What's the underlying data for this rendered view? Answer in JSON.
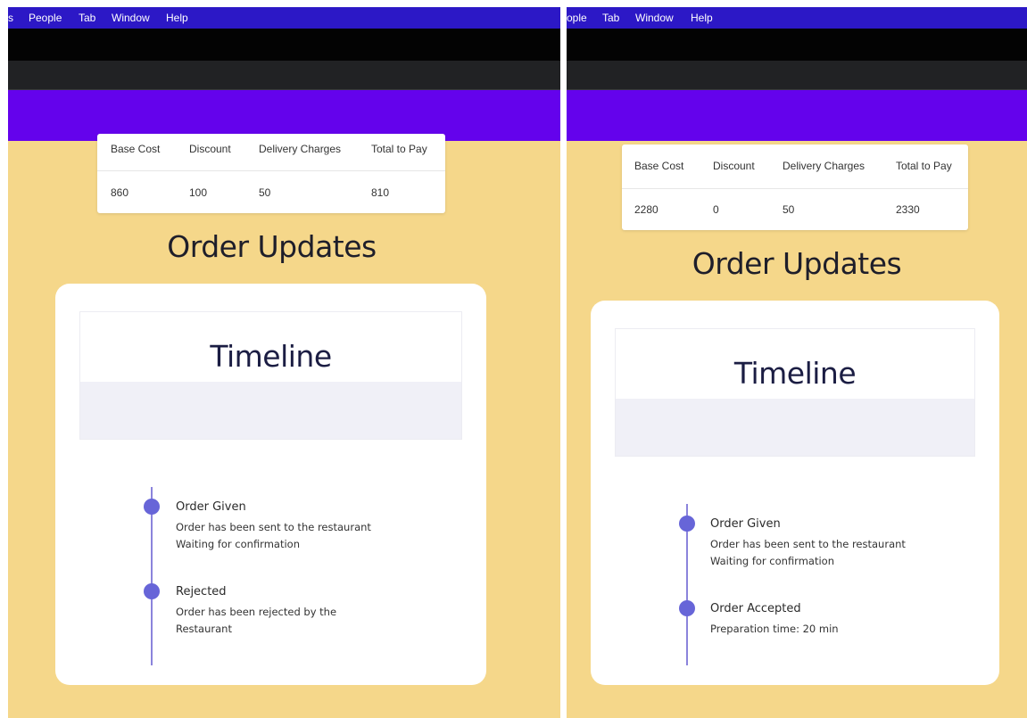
{
  "left": {
    "menu": [
      "s",
      "People",
      "Tab",
      "Window",
      "Help"
    ],
    "cost_headers": [
      "Base Cost",
      "Discount",
      "Delivery Charges",
      "Total to Pay"
    ],
    "cost_values": [
      "860",
      "100",
      "50",
      "810"
    ],
    "heading": "Order Updates",
    "timeline_title": "Timeline",
    "events": [
      {
        "title": "Order Given",
        "line1": "Order has been sent to the restaurant",
        "line2": "Waiting for confirmation"
      },
      {
        "title": "Rejected",
        "line1": "Order has been rejected by the",
        "line2": "Restaurant"
      }
    ]
  },
  "right": {
    "menu": [
      "ople",
      "Tab",
      "Window",
      "Help"
    ],
    "cost_headers": [
      "Base Cost",
      "Discount",
      "Delivery Charges",
      "Total to Pay"
    ],
    "cost_values": [
      "2280",
      "0",
      "50",
      "2330"
    ],
    "heading": "Order Updates",
    "timeline_title": "Timeline",
    "events": [
      {
        "title": "Order Given",
        "line1": "Order has been sent to the restaurant",
        "line2": "Waiting for confirmation"
      },
      {
        "title": "Order Accepted",
        "line1": "Preparation time: 20 min"
      }
    ]
  },
  "colors": {
    "background": "#f5d78a",
    "menubar": "#2c18c6",
    "header": "#6402ec",
    "timeline_dot": "#6765d8"
  }
}
